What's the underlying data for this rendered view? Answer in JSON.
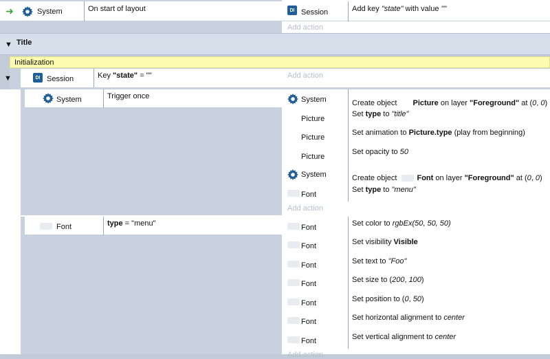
{
  "event1": {
    "cond_object": "System",
    "cond_text": "On start of layout",
    "act_object": "Session",
    "act_text_prefix": "Add key ",
    "act_key": "\"state\"",
    "act_text_mid": " with value ",
    "act_value": "\"\"",
    "add_action": "Add action"
  },
  "group": {
    "title": "Title",
    "description": "Initialization"
  },
  "event2": {
    "cond_object": "Session",
    "cond_text_prefix": "Key ",
    "cond_key": "\"state\"",
    "cond_text_suffix": " = \"\"",
    "add_action": "Add action"
  },
  "event3": {
    "cond_object": "System",
    "cond_text": "Trigger once",
    "add_action": "Add action",
    "actions": [
      {
        "object": "System",
        "parts": [
          "Create object ",
          "Picture",
          " on layer ",
          "\"Foreground\"",
          " at (",
          "0",
          ", ",
          "0",
          ")"
        ]
      },
      {
        "object": "Picture",
        "parts": [
          "Set ",
          "type",
          " to ",
          "\"title\""
        ]
      },
      {
        "object": "Picture",
        "parts": [
          "Set animation to ",
          "Picture.type",
          " (play from beginning)"
        ]
      },
      {
        "object": "Picture",
        "parts": [
          "Set opacity to ",
          "50"
        ]
      },
      {
        "object": "System",
        "parts": [
          "Create object ",
          "Font",
          " on layer ",
          "\"Foreground\"",
          " at (",
          "0",
          ", ",
          "0",
          ")"
        ]
      },
      {
        "object": "Font",
        "parts": [
          "Set ",
          "type",
          " to ",
          "\"menu\""
        ]
      }
    ]
  },
  "event4": {
    "cond_object": "Font",
    "cond_text_bold": "type",
    "cond_text_suffix": " = \"menu\"",
    "add_action": "Add action",
    "actions": [
      {
        "object": "Font",
        "parts": [
          "Set color to ",
          "rgbEx(50, 50, 50)"
        ]
      },
      {
        "object": "Font",
        "parts": [
          "Set visibility ",
          "Visible"
        ]
      },
      {
        "object": "Font",
        "parts": [
          "Set text to ",
          "\"Foo\""
        ]
      },
      {
        "object": "Font",
        "parts": [
          "Set size to (",
          "200",
          ", ",
          "100",
          ")"
        ]
      },
      {
        "object": "Font",
        "parts": [
          "Set position to (",
          "0",
          ", ",
          "50",
          ")"
        ]
      },
      {
        "object": "Font",
        "parts": [
          "Set horizontal alignment to ",
          "center"
        ]
      },
      {
        "object": "Font",
        "parts": [
          "Set vertical alignment to ",
          "center"
        ]
      }
    ]
  },
  "colors": {
    "group_header": "#d7e0ea",
    "comment": "#fdfbb0",
    "accent_green": "#39a33a",
    "gear": "#1f5f96"
  },
  "icons": {
    "trigger_arrow": "right-arrow-icon",
    "gear": "gear-icon",
    "session": "session-icon",
    "collapse": "triangle-down-icon"
  }
}
